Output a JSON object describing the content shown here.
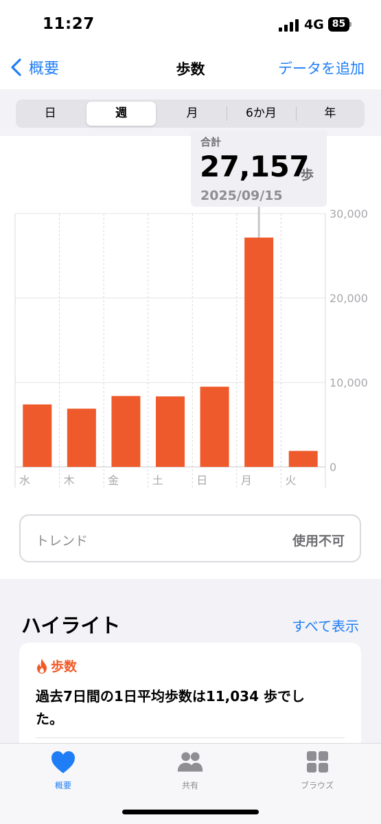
{
  "status_bar": {
    "time": "11:27",
    "network": "4G",
    "battery": "85"
  },
  "nav": {
    "back_label": "概要",
    "title": "歩数",
    "add_data_label": "データを追加"
  },
  "range_tabs": [
    {
      "label": "日",
      "active": false
    },
    {
      "label": "週",
      "active": true
    },
    {
      "label": "月",
      "active": false
    },
    {
      "label": "6か月",
      "active": false
    },
    {
      "label": "年",
      "active": false
    }
  ],
  "tooltip": {
    "label": "合計",
    "value": "27,157",
    "unit": "歩",
    "date": "2025/09/15"
  },
  "chart_data": {
    "type": "bar",
    "categories": [
      "水",
      "木",
      "金",
      "土",
      "日",
      "月",
      "火"
    ],
    "values": [
      7400,
      6900,
      8400,
      8350,
      9500,
      27157,
      1900
    ],
    "ylim": [
      0,
      30000
    ],
    "y_ticks": [
      "0",
      "10,000",
      "20,000",
      "30,000"
    ],
    "selected_index": 5,
    "bar_color": "#ee5a2b",
    "grid": true
  },
  "trend": {
    "label": "トレンド",
    "status": "使用不可"
  },
  "highlights": {
    "title": "ハイライト",
    "show_all_label": "すべて表示",
    "card": {
      "category": "歩数",
      "text": "過去7日間の1日平均歩数は11,034 歩でした。"
    }
  },
  "tab_bar": {
    "items": [
      {
        "label": "概要",
        "icon": "heart-icon",
        "active": true
      },
      {
        "label": "共有",
        "icon": "people-icon",
        "active": false
      },
      {
        "label": "ブラウズ",
        "icon": "grid-icon",
        "active": false
      }
    ]
  },
  "colors": {
    "accent": "#1f7ef6",
    "bar": "#ee5a2b",
    "inactive_tab": "#8e8e93"
  }
}
